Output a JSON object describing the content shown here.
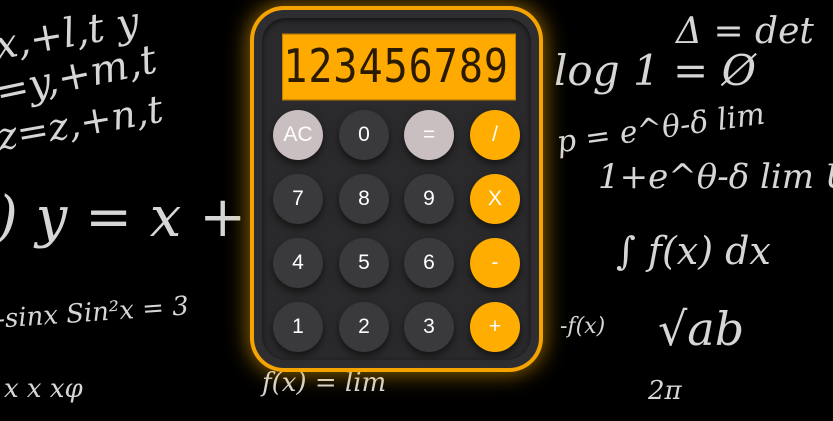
{
  "display": {
    "value": "123456789"
  },
  "buttons": {
    "row1": [
      "AC",
      "0",
      "=",
      "/"
    ],
    "row2": [
      "7",
      "8",
      "9",
      "X"
    ],
    "row3": [
      "4",
      "5",
      "6",
      "-"
    ],
    "row4": [
      "1",
      "2",
      "3",
      "+"
    ]
  },
  "colors": {
    "accent": "#ffad00",
    "body": "#2e2e30",
    "key": "#3a3a3c",
    "light_key": "#c9bec0",
    "background": "#000000"
  },
  "background_chalk": {
    "t1": "x,+l,t  y",
    "t2": "=y,+m,t",
    "t3": "z=z,+n,t",
    "t4": ") y = x +",
    "t5": "-sinx  Sin²x = 3",
    "t6": "x  x  xφ",
    "t7": "Δ = det",
    "t8": "log  1 = Ø",
    "t9": "p = e^θ-δ  lim",
    "t10": "1+e^θ-δ lim U",
    "t11": "∫  f(x) dx",
    "t12": "√ab",
    "t13": "-f(x)",
    "t14": "2π",
    "t15": "f(x) = lim"
  }
}
